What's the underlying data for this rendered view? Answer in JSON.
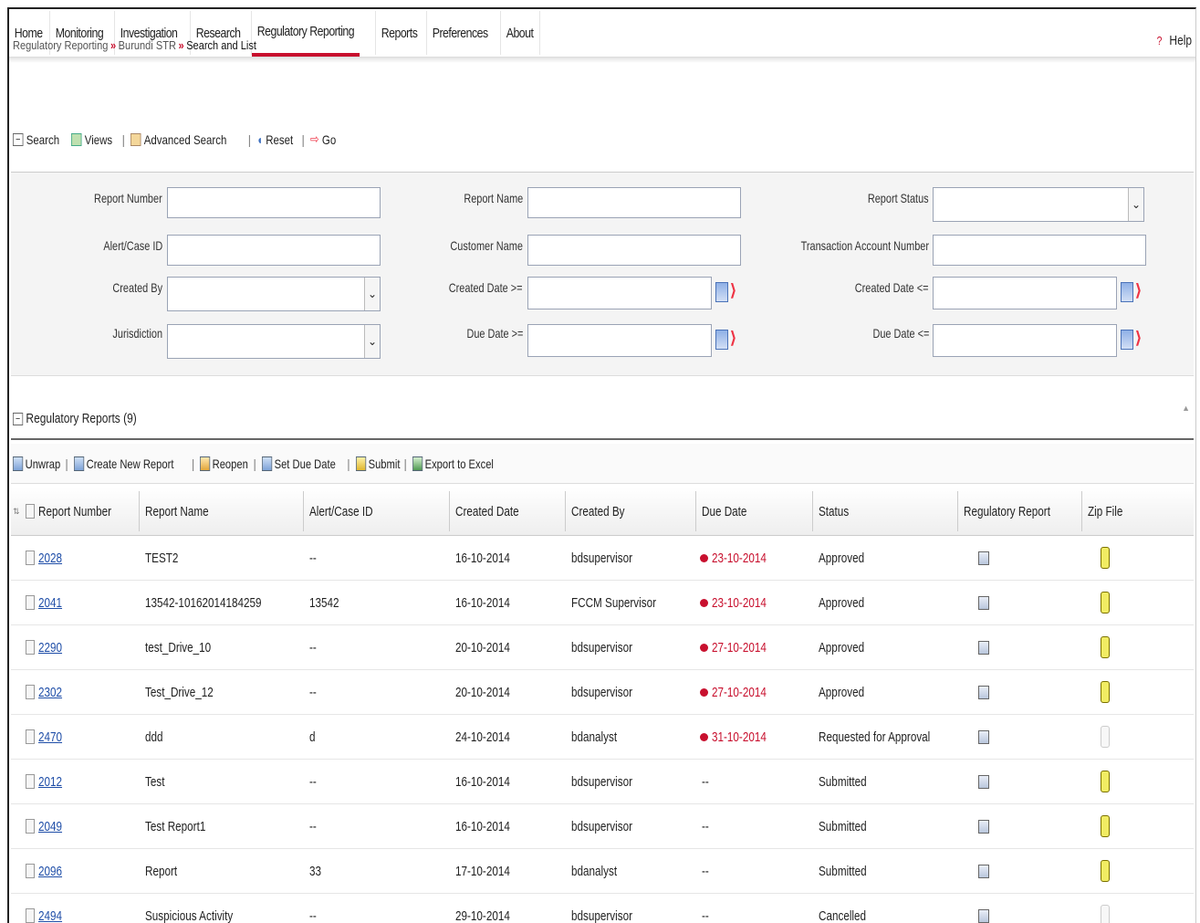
{
  "nav": {
    "items": [
      "Home",
      "Monitoring",
      "Investigation",
      "Research",
      "Regulatory Reporting",
      "Reports",
      "Preferences",
      "About"
    ],
    "active": "Regulatory Reporting"
  },
  "breadcrumb": {
    "level1": "Regulatory Reporting",
    "sep": "»",
    "level2": "Burundi STR",
    "current": "Search and List"
  },
  "help": {
    "label": "Help",
    "icon": "?"
  },
  "search_toolbar": {
    "search": "Search",
    "views": "Views",
    "advanced": "Advanced Search",
    "reset": "Reset",
    "go": "Go"
  },
  "search_form": {
    "report_number": "Report Number",
    "report_name": "Report Name",
    "report_status": "Report Status",
    "alert_case_id": "Alert/Case ID",
    "customer_name": "Customer Name",
    "transaction_account": "Transaction Account Number",
    "created_by": "Created By",
    "created_date_from": "Created Date >=",
    "created_date_to": "Created Date <=",
    "jurisdiction": "Jurisdiction",
    "due_date_from": "Due Date >=",
    "due_date_to": "Due Date <="
  },
  "section": {
    "title": "Regulatory Reports (9)"
  },
  "grid_toolbar": {
    "unwrap": "Unwrap",
    "create": "Create New Report",
    "reopen": "Reopen",
    "set_due": "Set Due Date",
    "submit": "Submit",
    "export": "Export to Excel"
  },
  "table": {
    "columns": [
      "Report Number",
      "Report Name",
      "Alert/Case ID",
      "Created Date",
      "Created By",
      "Due Date",
      "Status",
      "Regulatory Report",
      "Zip File"
    ],
    "rows": [
      {
        "number": "2028",
        "name": "TEST2",
        "case": "--",
        "created": "16-10-2014",
        "by": "bdsupervisor",
        "due": "23-10-2014",
        "overdue": true,
        "status": "Approved",
        "zip": true
      },
      {
        "number": "2041",
        "name": "13542-10162014184259",
        "case": "13542",
        "created": "16-10-2014",
        "by": "FCCM Supervisor",
        "due": "23-10-2014",
        "overdue": true,
        "status": "Approved",
        "zip": true
      },
      {
        "number": "2290",
        "name": "test_Drive_10",
        "case": "--",
        "created": "20-10-2014",
        "by": "bdsupervisor",
        "due": "27-10-2014",
        "overdue": true,
        "status": "Approved",
        "zip": true
      },
      {
        "number": "2302",
        "name": "Test_Drive_12",
        "case": "--",
        "created": "20-10-2014",
        "by": "bdsupervisor",
        "due": "27-10-2014",
        "overdue": true,
        "status": "Approved",
        "zip": true
      },
      {
        "number": "2470",
        "name": "ddd",
        "case": "d",
        "created": "24-10-2014",
        "by": "bdanalyst",
        "due": "31-10-2014",
        "overdue": true,
        "status": "Requested for Approval",
        "zip": false
      },
      {
        "number": "2012",
        "name": "Test",
        "case": "--",
        "created": "16-10-2014",
        "by": "bdsupervisor",
        "due": "--",
        "overdue": false,
        "status": "Submitted",
        "zip": true
      },
      {
        "number": "2049",
        "name": "Test Report1",
        "case": "--",
        "created": "16-10-2014",
        "by": "bdsupervisor",
        "due": "--",
        "overdue": false,
        "status": "Submitted",
        "zip": true
      },
      {
        "number": "2096",
        "name": "Report",
        "case": "33",
        "created": "17-10-2014",
        "by": "bdanalyst",
        "due": "--",
        "overdue": false,
        "status": "Submitted",
        "zip": true
      },
      {
        "number": "2494",
        "name": "Suspicious Activity",
        "case": "--",
        "created": "29-10-2014",
        "by": "bdsupervisor",
        "due": "--",
        "overdue": false,
        "status": "Cancelled",
        "zip": false
      }
    ]
  },
  "colors": {
    "accent": "#c8102e",
    "link": "#1f4ea8"
  }
}
